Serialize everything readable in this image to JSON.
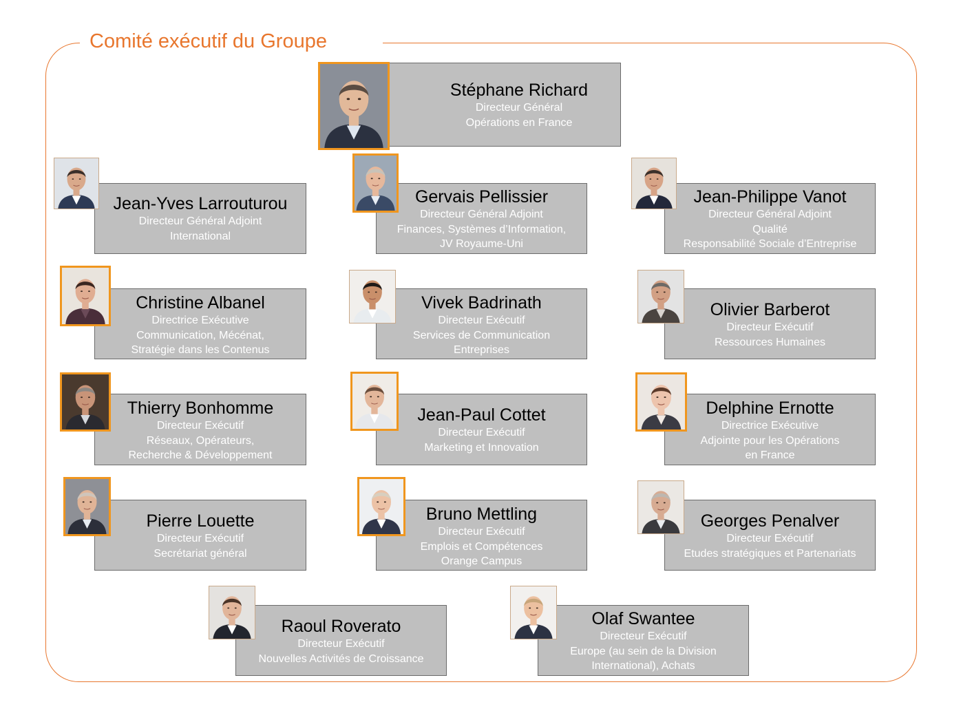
{
  "header": {
    "title": "Comité exécutif du Groupe"
  },
  "colors": {
    "accent": "#e8762d",
    "highlight": "#f0961e",
    "box": "#bfbfbf"
  },
  "ceo": {
    "name": "Stéphane Richard",
    "roles": [
      "Directeur Général",
      "Opérations en France"
    ],
    "photo": {
      "icon": "portrait-photo",
      "bg": "#8a8f98",
      "skin": "#e2b99a",
      "hair": "#5a4c42",
      "suit": "#2b3140",
      "shirt": "#dfe6f0",
      "highlighted": true
    }
  },
  "members": [
    {
      "name": "Jean-Yves Larrouturou",
      "roles": [
        "Directeur Général Adjoint",
        "International"
      ],
      "photo": {
        "icon": "portrait-photo",
        "bg": "#dfe3e8",
        "skin": "#d9a98b",
        "hair": "#3a2f2a",
        "suit": "#2e3a55",
        "shirt": "#ffffff",
        "highlighted": false
      }
    },
    {
      "name": "Gervais Pellissier",
      "roles": [
        "Directeur Général Adjoint",
        "Finances, Systèmes d’Information,",
        "JV Royaume-Uni"
      ],
      "photo": {
        "icon": "portrait-photo",
        "bg": "#9da9b6",
        "skin": "#e6b89c",
        "hair": "#c9c3b8",
        "suit": "#3a4a66",
        "shirt": "#e9eef5",
        "highlighted": true
      }
    },
    {
      "name": "Jean-Philippe Vanot",
      "roles": [
        "Directeur Général Adjoint",
        "Qualité",
        "Responsabilité Sociale d’Entreprise"
      ],
      "photo": {
        "icon": "portrait-photo",
        "bg": "#e6e2dc",
        "skin": "#d7a487",
        "hair": "#3b302b",
        "suit": "#23283a",
        "shirt": "#ffffff",
        "highlighted": false
      }
    },
    {
      "name": "Christine Albanel",
      "roles": [
        "Directrice Exécutive",
        "Communication, Mécénat,",
        "Stratégie dans les Contenus"
      ],
      "photo": {
        "icon": "portrait-photo",
        "bg": "#e9e4dd",
        "skin": "#e0ad92",
        "hair": "#3a2620",
        "suit": "#4a2e3a",
        "shirt": "#6b4a58",
        "highlighted": true
      }
    },
    {
      "name": "Vivek Badrinath",
      "roles": [
        "Directeur Exécutif",
        "Services de Communication",
        "Entreprises"
      ],
      "photo": {
        "icon": "portrait-photo",
        "bg": "#f1efec",
        "skin": "#c98f6a",
        "hair": "#1f1a18",
        "suit": "#e8ecef",
        "shirt": "#ffffff",
        "highlighted": false
      }
    },
    {
      "name": "Olivier Barberot",
      "roles": [
        "Directeur Exécutif",
        "Ressources Humaines"
      ],
      "photo": {
        "icon": "portrait-photo",
        "bg": "#e3e3e3",
        "skin": "#d2a084",
        "hair": "#6d6a66",
        "suit": "#4a4440",
        "shirt": "#d9d4cf",
        "highlighted": false
      }
    },
    {
      "name": "Thierry Bonhomme",
      "roles": [
        "Directeur Exécutif",
        "Réseaux, Opérateurs,",
        "Recherche & Développement"
      ],
      "photo": {
        "icon": "portrait-photo",
        "bg": "#4a3a2e",
        "skin": "#c89478",
        "hair": "#8c8782",
        "suit": "#2a2a30",
        "shirt": "#d6d9de",
        "highlighted": true
      }
    },
    {
      "name": "Jean-Paul Cottet",
      "roles": [
        "Directeur Exécutif",
        "Marketing et Innovation"
      ],
      "photo": {
        "icon": "portrait-photo",
        "bg": "#f0ece7",
        "skin": "#e3b69a",
        "hair": "#6a4d3c",
        "suit": "#e6e8ec",
        "shirt": "#ffffff",
        "highlighted": true
      }
    },
    {
      "name": "Delphine Ernotte",
      "roles": [
        "Directrice Exécutive",
        "Adjointe pour les Opérations",
        "en France"
      ],
      "photo": {
        "icon": "portrait-photo",
        "bg": "#ece7e2",
        "skin": "#edc4ad",
        "hair": "#5b3a2a",
        "suit": "#3b3b44",
        "shirt": "#f1e9e4",
        "highlighted": true
      }
    },
    {
      "name": "Pierre Louette",
      "roles": [
        "Directeur Exécutif",
        "Secrétariat général"
      ],
      "photo": {
        "icon": "portrait-photo",
        "bg": "#8e9096",
        "skin": "#e0b497",
        "hair": "#cfc5bb",
        "suit": "#2c2f3a",
        "shirt": "#e7ecf2",
        "highlighted": true
      }
    },
    {
      "name": "Bruno Mettling",
      "roles": [
        "Directeur Exécutif",
        "Emplois et Compétences",
        "Orange Campus"
      ],
      "photo": {
        "icon": "portrait-photo",
        "bg": "#eef0f2",
        "skin": "#ecc2a6",
        "hair": "#d8cfbf",
        "suit": "#30364a",
        "shirt": "#ffffff",
        "highlighted": true
      }
    },
    {
      "name": "Georges Penalver",
      "roles": [
        "Directeur Exécutif",
        "Etudes stratégiques et Partenariats"
      ],
      "photo": {
        "icon": "portrait-photo",
        "bg": "#ebe8e4",
        "skin": "#d7ab92",
        "hair": "#bdb7b0",
        "suit": "#3a3a3e",
        "shirt": "#e9ecef",
        "highlighted": false
      }
    },
    {
      "name": "Raoul Roverato",
      "roles": [
        "Directeur Exécutif",
        "Nouvelles Activités de Croissance"
      ],
      "photo": {
        "icon": "portrait-photo",
        "bg": "#e4e2df",
        "skin": "#e1b59a",
        "hair": "#4a3428",
        "suit": "#22252e",
        "shirt": "#ffffff",
        "highlighted": false
      }
    },
    {
      "name": "Olaf Swantee",
      "roles": [
        "Directeur Exécutif",
        "Europe (au sein de la Division",
        "International), Achats"
      ],
      "photo": {
        "icon": "portrait-photo",
        "bg": "#f2f0ee",
        "skin": "#ecc0a0",
        "hair": "#c7a57a",
        "suit": "#2c3243",
        "shirt": "#ffffff",
        "highlighted": false
      }
    }
  ]
}
